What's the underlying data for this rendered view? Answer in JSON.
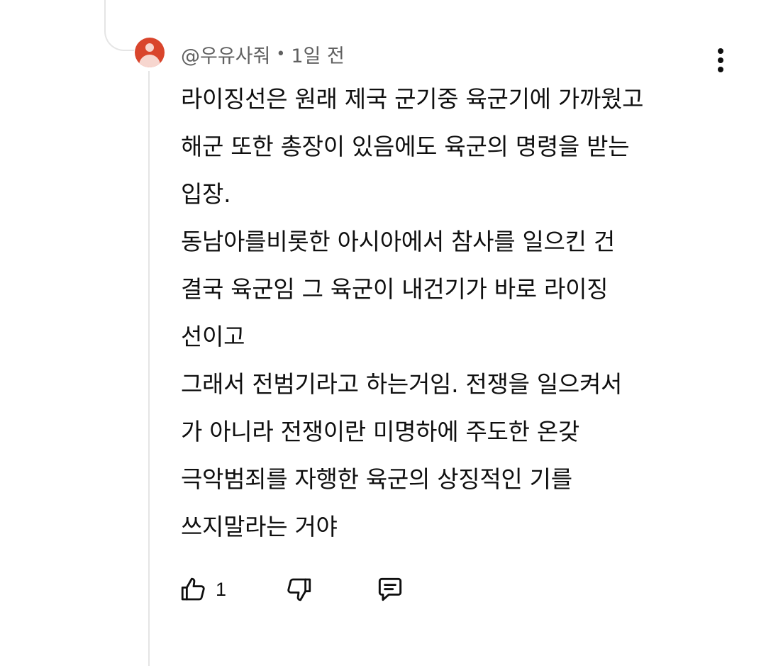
{
  "comment": {
    "author": "@우유사줘",
    "separator": "•",
    "timestamp": "1일 전",
    "lines": [
      "라이징선은 원래 제국 군기중 육군기에 가까웠고",
      "해군 또한 총장이 있음에도 육군의 명령을 받는",
      "입장.",
      "동남아를비롯한 아시아에서 참사를 일으킨 건",
      "결국 육군임 그 육군이 내건기가 바로 라이징",
      "선이고",
      "그래서 전범기라고 하는거임. 전쟁을 일으켜서",
      "가 아니라 전쟁이란 미명하에 주도한 온갖",
      "극악범죄를 자행한 육군의 상징적인 기를",
      "쓰지말라는 거야"
    ],
    "like_count": "1"
  },
  "icons": {
    "avatar": "default-avatar-icon",
    "menu": "more-vertical-icon",
    "like": "thumbs-up-icon",
    "dislike": "thumbs-down-icon",
    "reply": "reply-comment-icon"
  },
  "colors": {
    "avatar_bg": "#d9452c",
    "text_primary": "#0f0f0f",
    "text_secondary": "#606060",
    "thread_line": "#e5e5e5"
  }
}
